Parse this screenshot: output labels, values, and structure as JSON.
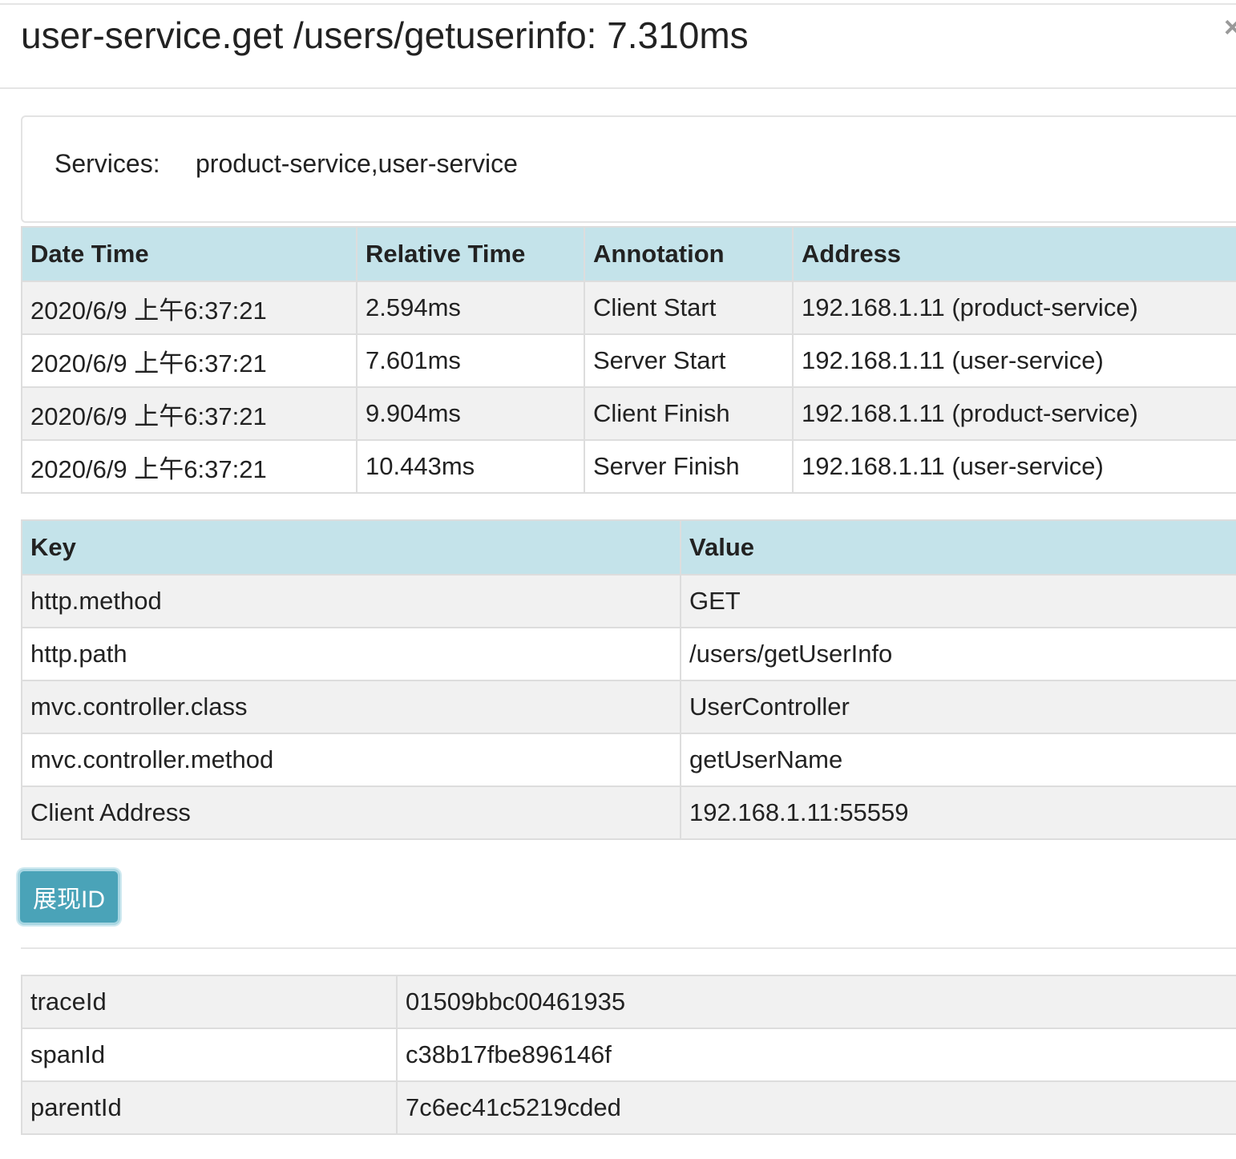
{
  "modal": {
    "title": "user-service.get /users/getuserinfo: 7.310ms",
    "close": "×"
  },
  "services": {
    "label": "Services:",
    "value": "product-service,user-service"
  },
  "annotations": {
    "headers": [
      "Date Time",
      "Relative Time",
      "Annotation",
      "Address"
    ],
    "rows": [
      [
        "2020/6/9 上午6:37:21",
        "2.594ms",
        "Client Start",
        "192.168.1.11 (product-service)"
      ],
      [
        "2020/6/9 上午6:37:21",
        "7.601ms",
        "Server Start",
        "192.168.1.11 (user-service)"
      ],
      [
        "2020/6/9 上午6:37:21",
        "9.904ms",
        "Client Finish",
        "192.168.1.11 (product-service)"
      ],
      [
        "2020/6/9 上午6:37:21",
        "10.443ms",
        "Server Finish",
        "192.168.1.11 (user-service)"
      ]
    ]
  },
  "tags": {
    "headers": [
      "Key",
      "Value"
    ],
    "rows": [
      [
        "http.method",
        "GET"
      ],
      [
        "http.path",
        "/users/getUserInfo"
      ],
      [
        "mvc.controller.class",
        "UserController"
      ],
      [
        "mvc.controller.method",
        "getUserName"
      ],
      [
        "Client Address",
        "192.168.1.11:55559"
      ]
    ]
  },
  "show_id_button": "展现ID",
  "ids": {
    "rows": [
      [
        "traceId",
        "01509bbc00461935"
      ],
      [
        "spanId",
        "c38b17fbe896146f"
      ],
      [
        "parentId",
        "7c6ec41c5219cded"
      ]
    ]
  },
  "colors": {
    "header_bg": "#c4e3ea",
    "stripe_bg": "#f1f1f1",
    "button_bg": "#4aa3b8"
  }
}
